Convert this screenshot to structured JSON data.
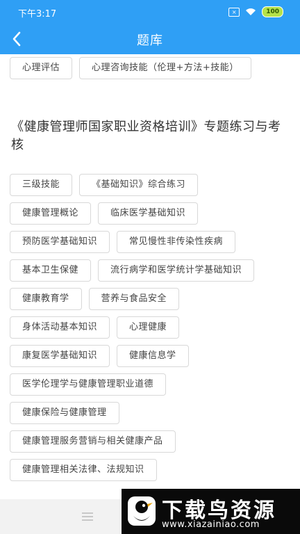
{
  "status_bar": {
    "time": "下午3:17",
    "battery": "100"
  },
  "nav": {
    "title": "题库"
  },
  "top_tags": [
    {
      "label": "心理评估"
    },
    {
      "label": "心理咨询技能（伦理+方法+技能）"
    }
  ],
  "section": {
    "title": "《健康管理师国家职业资格培训》专题练习与考核",
    "tags": [
      {
        "label": "三级技能"
      },
      {
        "label": "《基础知识》综合练习"
      },
      {
        "label": "健康管理概论"
      },
      {
        "label": "临床医学基础知识"
      },
      {
        "label": "预防医学基础知识"
      },
      {
        "label": "常见慢性非传染性疾病"
      },
      {
        "label": "基本卫生保健"
      },
      {
        "label": "流行病学和医学统计学基础知识"
      },
      {
        "label": "健康教育学"
      },
      {
        "label": "营养与食品安全"
      },
      {
        "label": "身体活动基本知识"
      },
      {
        "label": "心理健康"
      },
      {
        "label": "康复医学基础知识"
      },
      {
        "label": "健康信息学"
      },
      {
        "label": "医学伦理学与健康管理职业道德"
      },
      {
        "label": "健康保险与健康管理"
      },
      {
        "label": "健康管理服务营销与相关健康产品"
      },
      {
        "label": "健康管理相关法律、法规知识"
      }
    ]
  },
  "watermark": {
    "title": "下载鸟资源",
    "url": "www.xiazainiao.com"
  },
  "colors": {
    "header": "#2f9ff5",
    "tag_border": "#d8d8d8",
    "bottom_bar": "#f2f2f2"
  }
}
